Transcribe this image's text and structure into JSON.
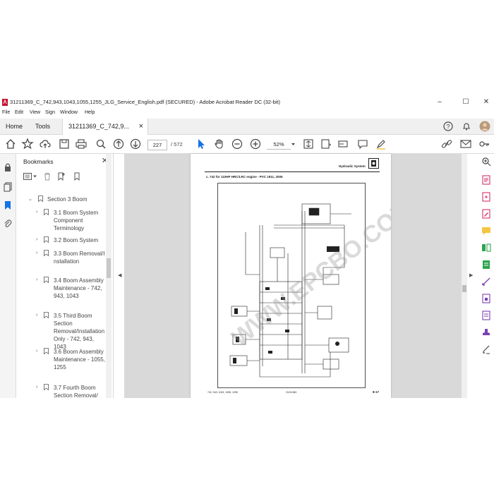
{
  "window": {
    "title": "31211369_C_742,943,1043,1055,1255_JLG_Service_English.pdf (SECURED) - Adobe Acrobat Reader DC (32-bit)",
    "controls": {
      "minimize": "–",
      "maximize": "☐",
      "close": "✕"
    }
  },
  "menu": {
    "items": [
      "File",
      "Edit",
      "View",
      "Sign",
      "Window",
      "Help"
    ]
  },
  "tabs": {
    "home": "Home",
    "tools": "Tools",
    "document": "31211369_C_742,9...",
    "close": "×"
  },
  "toolbar": {
    "current_page": "227",
    "total_pages": "/ 572",
    "zoom": "52%"
  },
  "bookmarks": {
    "header": "Bookmarks",
    "items": [
      {
        "label": "Section 3 Boom",
        "level": 1
      },
      {
        "label": "3.1 Boom System Component Terminology",
        "level": 2
      },
      {
        "label": "3.2 Boom System",
        "level": 2
      },
      {
        "label": "3.3 Boom Removal/Installation",
        "level": 2
      },
      {
        "label": "3.4 Boom Assembly Maintenance - 742, 943, 1043",
        "level": 2
      },
      {
        "label": "3.5 Third Boom Section Removal/Installation Only - 742, 943, 1043",
        "level": 2
      },
      {
        "label": "3.6 Boom Assembly Maintenance - 1055, 1255",
        "level": 2
      },
      {
        "label": "3.7 Fourth Boom Section Removal/",
        "level": 2
      }
    ]
  },
  "document": {
    "header_right": "Hydraulic System",
    "subtitle": "c.   742 for 110HP HRC/LRC engine - PVC 1911, 2005",
    "footer_left": "742, 943, 1043, 1055, 1255",
    "footer_center": "31211369",
    "footer_right": "8-17",
    "watermark": "WWW.EPCBO.COM"
  },
  "colors": {
    "accent": "#1473e6",
    "adobe_red": "#c4122f",
    "rail_green": "#2da44e",
    "rail_purple": "#7b3fb5",
    "rail_pink": "#d6336c"
  }
}
